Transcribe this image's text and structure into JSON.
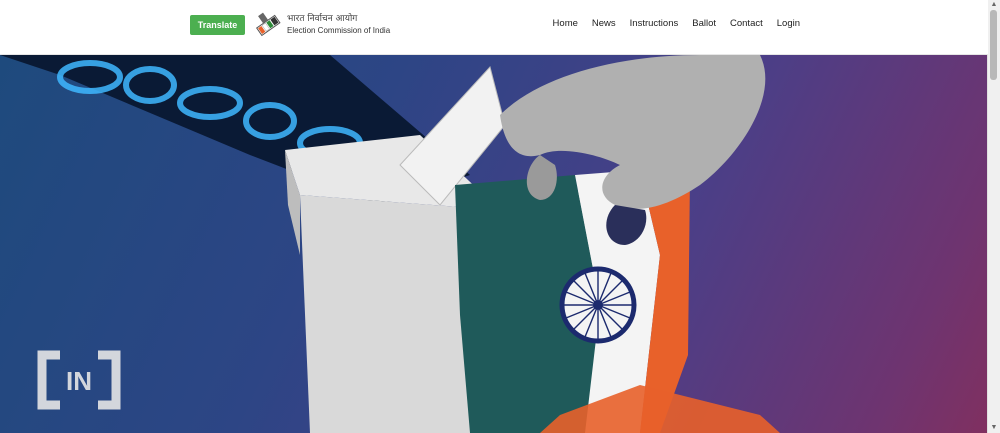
{
  "header": {
    "translate_label": "Translate",
    "brand_hindi": "भारत निर्वाचन आयोग",
    "brand_english": "Election Commission of India",
    "nav": [
      "Home",
      "News",
      "Instructions",
      "Ballot",
      "Contact",
      "Login"
    ]
  },
  "hero": {
    "watermark": "[IN]"
  },
  "colors": {
    "translate_bg": "#4caf50",
    "saffron": "#e8612a",
    "flag_green": "#1f5a5a",
    "chakra_navy": "#1c2a6e"
  }
}
